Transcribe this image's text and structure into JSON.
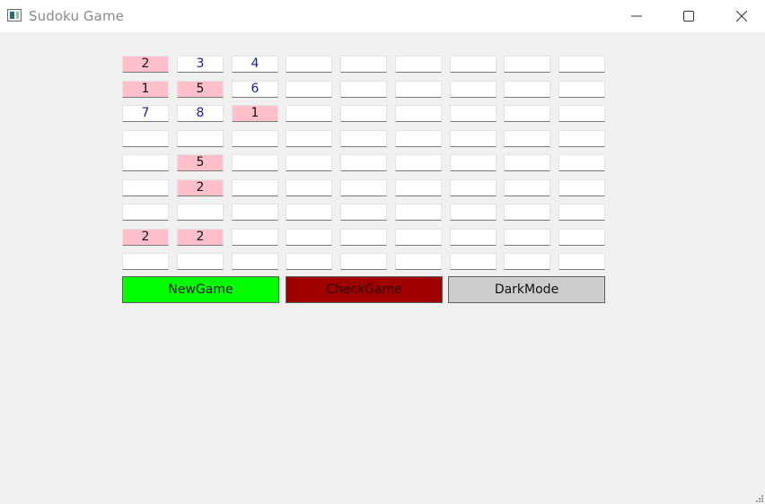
{
  "window": {
    "title": "Sudoku Game",
    "app_icon": "window-app-icon",
    "controls": {
      "minimize_icon": "minimize-icon",
      "maximize_icon": "maximize-icon",
      "close_icon": "close-icon"
    }
  },
  "board": {
    "size": 9,
    "rows": [
      [
        {
          "v": "2",
          "conflict": true
        },
        {
          "v": "3",
          "conflict": false
        },
        {
          "v": "4",
          "conflict": false
        },
        {
          "v": "",
          "conflict": false
        },
        {
          "v": "",
          "conflict": false
        },
        {
          "v": "",
          "conflict": false
        },
        {
          "v": "",
          "conflict": false
        },
        {
          "v": "",
          "conflict": false
        },
        {
          "v": "",
          "conflict": false
        }
      ],
      [
        {
          "v": "1",
          "conflict": true
        },
        {
          "v": "5",
          "conflict": true
        },
        {
          "v": "6",
          "conflict": false
        },
        {
          "v": "",
          "conflict": false
        },
        {
          "v": "",
          "conflict": false
        },
        {
          "v": "",
          "conflict": false
        },
        {
          "v": "",
          "conflict": false
        },
        {
          "v": "",
          "conflict": false
        },
        {
          "v": "",
          "conflict": false
        }
      ],
      [
        {
          "v": "7",
          "conflict": false
        },
        {
          "v": "8",
          "conflict": false
        },
        {
          "v": "1",
          "conflict": true
        },
        {
          "v": "",
          "conflict": false
        },
        {
          "v": "",
          "conflict": false
        },
        {
          "v": "",
          "conflict": false
        },
        {
          "v": "",
          "conflict": false
        },
        {
          "v": "",
          "conflict": false
        },
        {
          "v": "",
          "conflict": false
        }
      ],
      [
        {
          "v": "",
          "conflict": false
        },
        {
          "v": "",
          "conflict": false
        },
        {
          "v": "",
          "conflict": false
        },
        {
          "v": "",
          "conflict": false
        },
        {
          "v": "",
          "conflict": false
        },
        {
          "v": "",
          "conflict": false
        },
        {
          "v": "",
          "conflict": false
        },
        {
          "v": "",
          "conflict": false
        },
        {
          "v": "",
          "conflict": false
        }
      ],
      [
        {
          "v": "",
          "conflict": false
        },
        {
          "v": "5",
          "conflict": true
        },
        {
          "v": "",
          "conflict": false
        },
        {
          "v": "",
          "conflict": false
        },
        {
          "v": "",
          "conflict": false
        },
        {
          "v": "",
          "conflict": false
        },
        {
          "v": "",
          "conflict": false
        },
        {
          "v": "",
          "conflict": false
        },
        {
          "v": "",
          "conflict": false
        }
      ],
      [
        {
          "v": "",
          "conflict": false
        },
        {
          "v": "2",
          "conflict": true
        },
        {
          "v": "",
          "conflict": false
        },
        {
          "v": "",
          "conflict": false
        },
        {
          "v": "",
          "conflict": false
        },
        {
          "v": "",
          "conflict": false
        },
        {
          "v": "",
          "conflict": false
        },
        {
          "v": "",
          "conflict": false
        },
        {
          "v": "",
          "conflict": false
        }
      ],
      [
        {
          "v": "",
          "conflict": false
        },
        {
          "v": "",
          "conflict": false
        },
        {
          "v": "",
          "conflict": false
        },
        {
          "v": "",
          "conflict": false
        },
        {
          "v": "",
          "conflict": false
        },
        {
          "v": "",
          "conflict": false
        },
        {
          "v": "",
          "conflict": false
        },
        {
          "v": "",
          "conflict": false
        },
        {
          "v": "",
          "conflict": false
        }
      ],
      [
        {
          "v": "2",
          "conflict": true
        },
        {
          "v": "2",
          "conflict": true
        },
        {
          "v": "",
          "conflict": false
        },
        {
          "v": "",
          "conflict": false
        },
        {
          "v": "",
          "conflict": false
        },
        {
          "v": "",
          "conflict": false
        },
        {
          "v": "",
          "conflict": false
        },
        {
          "v": "",
          "conflict": false
        },
        {
          "v": "",
          "conflict": false
        }
      ],
      [
        {
          "v": "",
          "conflict": false
        },
        {
          "v": "",
          "conflict": false
        },
        {
          "v": "",
          "conflict": false
        },
        {
          "v": "",
          "conflict": false
        },
        {
          "v": "",
          "conflict": false
        },
        {
          "v": "",
          "conflict": false
        },
        {
          "v": "",
          "conflict": false
        },
        {
          "v": "",
          "conflict": false
        },
        {
          "v": "",
          "conflict": false
        }
      ]
    ]
  },
  "buttons": {
    "new_game": {
      "label": "NewGame",
      "color": "#00ff00"
    },
    "check_game": {
      "label": "CheckGame",
      "color": "#a00000"
    },
    "dark_mode": {
      "label": "DarkMode",
      "color": "#cccccc"
    }
  },
  "colors": {
    "conflict_cell": "#ffc0cb",
    "given_digit": "#1a1aa8",
    "window_background": "#f0f0f0"
  },
  "resize_grip": "resize-grip-icon"
}
